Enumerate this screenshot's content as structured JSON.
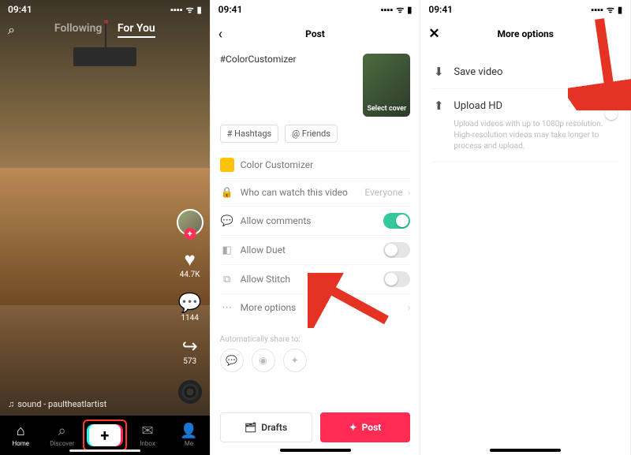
{
  "status": {
    "time": "09:41",
    "signal": "▪▪▪▪",
    "wifi": "ᯤ",
    "battery": "▮"
  },
  "screen1": {
    "search_icon": "⌕",
    "tab_following": "Following",
    "tab_foryou": "For You",
    "avatar_plus": "+",
    "like_count": "44.7K",
    "comment_count": "1144",
    "share_count": "573",
    "sound_prefix": "♫",
    "sound_text": "sound - paultheatlartist",
    "nav": {
      "home": "Home",
      "discover": "Discover",
      "inbox": "Inbox",
      "me": "Me"
    }
  },
  "screen2": {
    "title": "Post",
    "caption": "#ColorCustomizer",
    "cover_label": "Select cover",
    "chip_hashtags": "# Hashtags",
    "chip_friends": "@ Friends",
    "link_color": "Color Customizer",
    "who_label": "Who can watch this video",
    "who_value": "Everyone",
    "allow_comments": "Allow comments",
    "allow_duet": "Allow Duet",
    "allow_stitch": "Allow Stitch",
    "more_options": "More options",
    "auto_share": "Automatically share to:",
    "drafts": "Drafts",
    "post": "Post"
  },
  "screen3": {
    "title": "More options",
    "save_video": "Save video",
    "upload_hd": "Upload HD",
    "upload_hint": "Upload videos with up to 1080p resolution. High-resolution videos may take longer to process and upload."
  }
}
